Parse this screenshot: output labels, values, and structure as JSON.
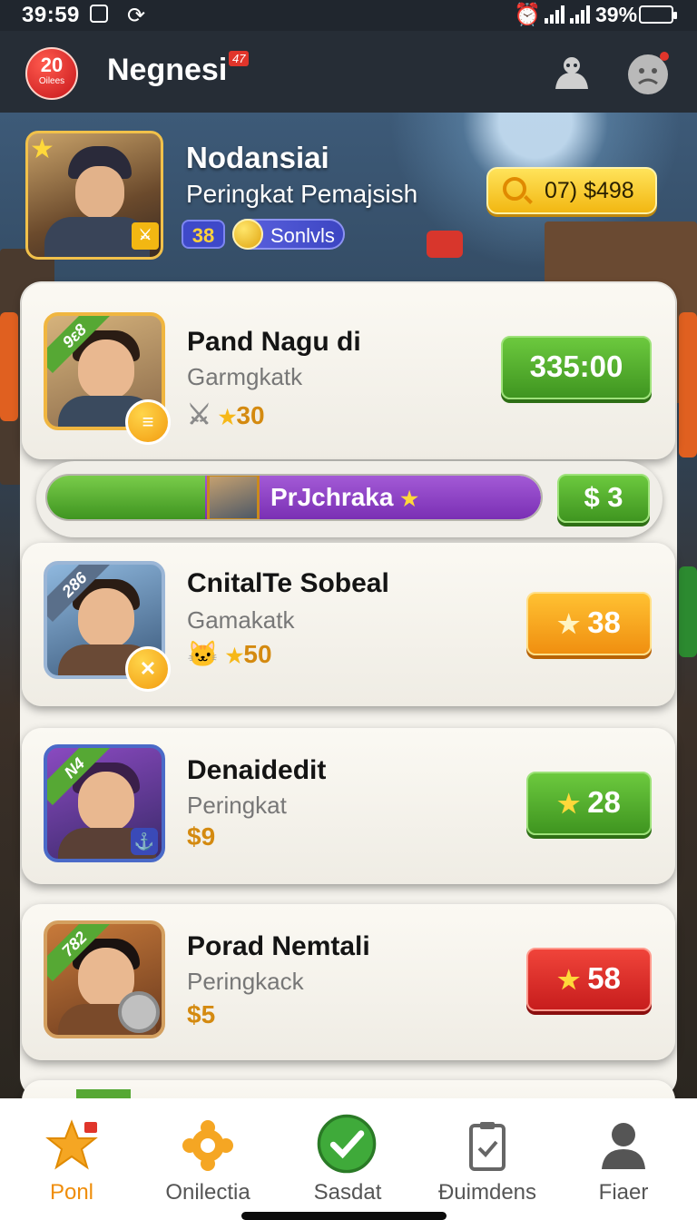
{
  "status_bar": {
    "time": "39:59",
    "battery": "39%"
  },
  "header": {
    "badge_count": "20",
    "badge_sub": "Oilees",
    "title": "Negnesi",
    "notif": "47",
    "colors": {
      "bar": "#262d36",
      "badge": "#e0352b"
    }
  },
  "profile": {
    "name": "Nodansiai",
    "rank_label": "Peringkat Pemajsish",
    "level": "38",
    "coin_label": "Sonlvls",
    "balance": "07) $498"
  },
  "cards": [
    {
      "rank": "9ɛ8",
      "name": "Pand Nagu di",
      "subtitle": "Garmgkatk",
      "stat": "30",
      "button": "335:00",
      "button_color": "green"
    },
    {
      "rank": "286",
      "name": "CnitalTe Sobeal",
      "subtitle": "Gamakatk",
      "stat": "50",
      "button": "38",
      "button_color": "orange"
    },
    {
      "rank": "N4",
      "name": "Denaidedit",
      "subtitle": "Peringkat",
      "stat": "$9",
      "button": "28",
      "button_color": "green"
    },
    {
      "rank": "782",
      "name": "Porad Nemtali",
      "subtitle": "Peringkack",
      "stat": "$5",
      "button": "58",
      "button_color": "red"
    }
  ],
  "progress": {
    "label": "PrJchraka",
    "value": 0.32,
    "button": "$ 3"
  },
  "nav": [
    {
      "label": "Ponl",
      "icon": "star-icon",
      "active": true
    },
    {
      "label": "Onilectia",
      "icon": "gear-icon",
      "active": false
    },
    {
      "label": "Sasdat",
      "icon": "check-circle-icon",
      "active": false
    },
    {
      "label": "Đuimdens",
      "icon": "clipboard-icon",
      "active": false
    },
    {
      "label": "Fiaer",
      "icon": "person-icon",
      "active": false
    }
  ]
}
